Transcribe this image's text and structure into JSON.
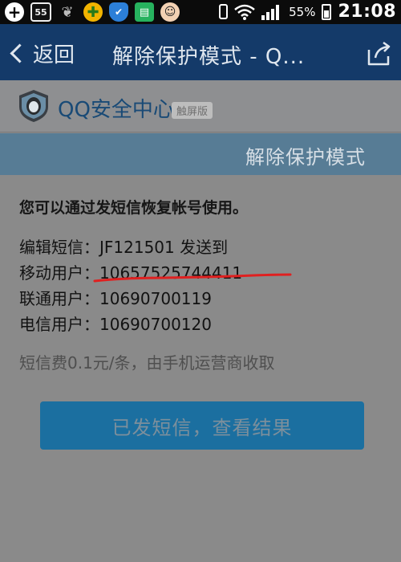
{
  "status_bar": {
    "icons": [
      "add-icon",
      "badge-55-icon",
      "leaf-icon",
      "plus-icon",
      "shield-icon",
      "book-icon",
      "avatar-icon"
    ],
    "badge_text": "55",
    "battery_percent": "55%",
    "time": "21:08"
  },
  "titlebar": {
    "back_label": "返回",
    "title": "解除保护模式 - Q..."
  },
  "header": {
    "app_name": "QQ安全中心",
    "badge": "触屏版"
  },
  "section": {
    "title": "解除保护模式"
  },
  "content": {
    "intro": "您可以通过发短信恢复帐号使用。",
    "lines": [
      "编辑短信：JF121501 发送到",
      "移动用户：10657525744411",
      "联通用户：10690700119",
      "电信用户：10690700120"
    ],
    "fee": "短信费0.1元/条，由手机运营商收取",
    "button_label": "已发短信，查看结果"
  },
  "colors": {
    "titlebar_bg": "#143a69",
    "section_bar_bg": "#577c95",
    "button_bg": "#1b6fa0",
    "underline": "#e02020"
  }
}
